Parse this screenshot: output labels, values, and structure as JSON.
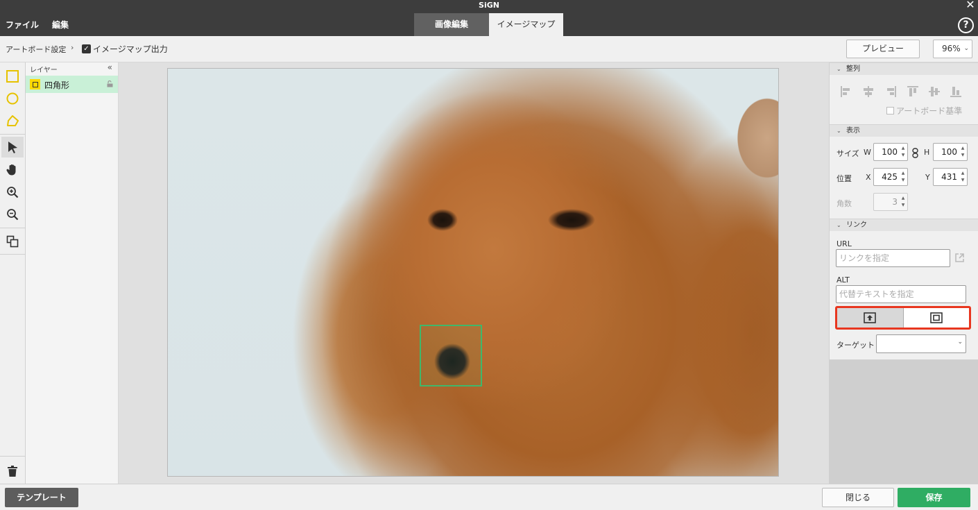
{
  "app": {
    "title": "SiGN"
  },
  "menu": {
    "file": "ファイル",
    "edit": "編集"
  },
  "tabs": [
    {
      "label": "画像編集"
    },
    {
      "label": "イメージマップ"
    }
  ],
  "toolbar": {
    "artboard_settings": "アートボード設定",
    "separator": "›",
    "imagemap_output_label": "イメージマップ出力",
    "imagemap_output_checked": true,
    "preview_label": "プレビュー",
    "zoom": "96%"
  },
  "tools": [
    "rectangle-tool-icon",
    "ellipse-tool-icon",
    "polygon-tool-icon",
    "select-arrow-icon",
    "hand-icon",
    "zoom-in-icon",
    "zoom-out-icon",
    "duplicate-icon",
    "trash-icon"
  ],
  "layers": {
    "title": "レイヤー",
    "collapse": "«",
    "items": [
      {
        "name": "四角形",
        "type": "rectangle",
        "locked": false,
        "selected": true
      }
    ]
  },
  "canvas": {
    "image": "dachshund-photo",
    "hotspot_shape": "rectangle"
  },
  "panel": {
    "align": {
      "title": "整列",
      "artboard_basis": "アートボード基準"
    },
    "display": {
      "title": "表示",
      "size_label": "サイズ",
      "w_label": "W",
      "w_value": "100",
      "h_label": "H",
      "h_value": "100",
      "position_label": "位置",
      "x_label": "X",
      "x_value": "425",
      "y_label": "Y",
      "y_value": "431",
      "corners_label": "角数",
      "corners_value": "3"
    },
    "link": {
      "title": "リンク",
      "url_label": "URL",
      "url_placeholder": "リンクを指定",
      "alt_label": "ALT",
      "alt_placeholder": "代替テキストを指定",
      "target_label": "ターゲット",
      "target_value": ""
    }
  },
  "footer": {
    "template": "テンプレート",
    "close": "閉じる",
    "save": "保存"
  },
  "colors": {
    "accent_green": "#2fad63",
    "hotspot": "#3fb86b",
    "highlight_red": "#e8361f",
    "shape_yellow": "#ffd800"
  }
}
